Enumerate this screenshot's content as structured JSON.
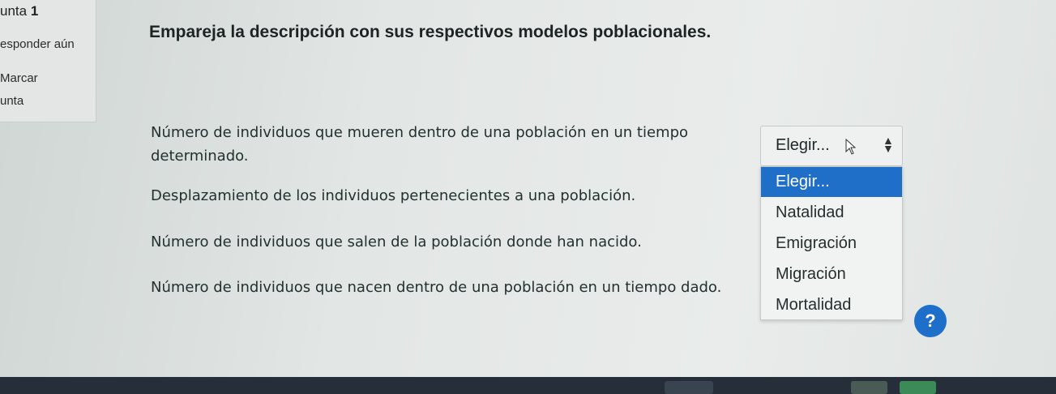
{
  "question_info": {
    "number_prefix": "unta",
    "number": "1",
    "status": "esponder aún",
    "flag": "Marcar",
    "edit": "unta"
  },
  "question": {
    "title": "Empareja la descripción con sus respectivos modelos poblacionales.",
    "items": [
      {
        "text": "Número de individuos que mueren dentro de una población en un tiempo determinado."
      },
      {
        "text": "Desplazamiento de los individuos pertenecientes a una población."
      },
      {
        "text": "Número de individuos que salen de la población donde han nacido."
      },
      {
        "text": "Número de individuos que nacen dentro de una población en un tiempo dado."
      }
    ]
  },
  "select": {
    "value": "Elegir...",
    "options": [
      "Elegir...",
      "Natalidad",
      "Emigración",
      "Migración",
      "Mortalidad"
    ],
    "highlighted_index": 0
  },
  "help_button": {
    "label": "?"
  },
  "colors": {
    "accent": "#1f6fc9",
    "taskbar": "#262e3a"
  }
}
